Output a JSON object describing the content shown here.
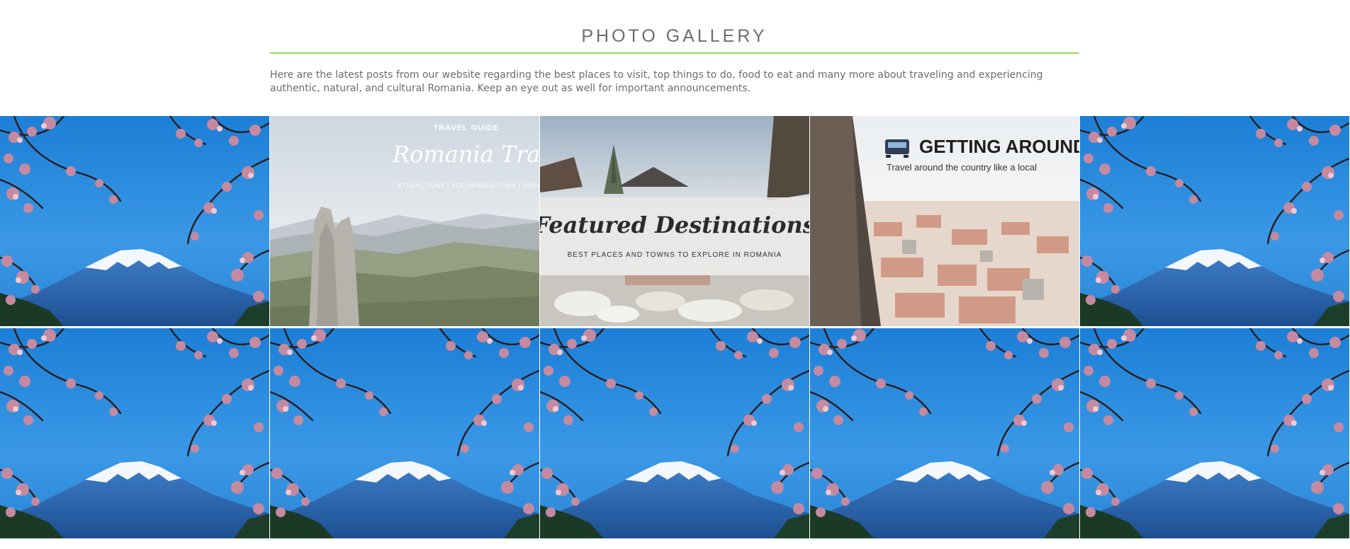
{
  "section": {
    "title": "PHOTO GALLERY",
    "intro": "Here are the latest posts from our website regarding the best places to visit, top things to do, food to eat and many more about traveling and experiencing authentic, natural, and cultural Romania. Keep an eye out as well for important announcements."
  },
  "colors": {
    "accent_rule": "#8fdc5c",
    "title_text": "#6d6d6d",
    "body_text": "#6b6b6b"
  },
  "gallery": {
    "tiles": [
      {
        "type": "fuji-photo"
      },
      {
        "type": "travel-guide",
        "kicker": "TRAVEL GUIDE",
        "script": "Romania Travel",
        "sub": "ATTRACTIONS | ACCOMMODATIONS | DINING"
      },
      {
        "type": "featured",
        "script": "Featured Destinations",
        "sub": "BEST PLACES AND TOWNS TO EXPLORE IN ROMANIA"
      },
      {
        "type": "getting-around",
        "heading": "GETTING AROUND",
        "sub": "Travel around the country like a local",
        "icon": "bus-icon"
      },
      {
        "type": "fuji-photo"
      },
      {
        "type": "fuji-photo"
      },
      {
        "type": "fuji-photo"
      },
      {
        "type": "fuji-photo"
      },
      {
        "type": "fuji-photo"
      },
      {
        "type": "fuji-photo"
      }
    ]
  }
}
